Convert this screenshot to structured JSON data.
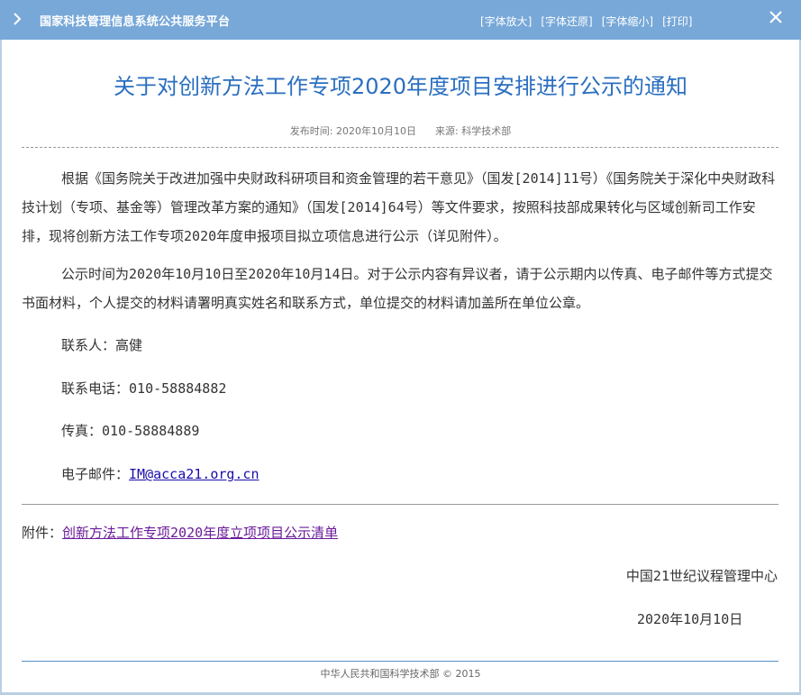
{
  "header": {
    "site_name": "国家科技管理信息系统公共服务平台",
    "tools": [
      "[字体放大]",
      "[字体还原]",
      "[字体缩小]",
      "[打印]"
    ]
  },
  "article": {
    "title": "关于对创新方法工作专项2020年度项目安排进行公示的通知",
    "publish_label": "发布时间:",
    "publish_date": "2020年10月10日",
    "source_label": "来源:",
    "source": "科学技术部",
    "paragraph1": "根据《国务院关于改进加强中央财政科研项目和资金管理的若干意见》（国发[2014]11号）《国务院关于深化中央财政科技计划（专项、基金等）管理改革方案的通知》（国发[2014]64号）等文件要求，按照科技部成果转化与区域创新司工作安排，现将创新方法工作专项2020年度申报项目拟立项信息进行公示（详见附件）。",
    "paragraph2": "公示时间为2020年10月10日至2020年10月14日。对于公示内容有异议者，请于公示期内以传真、电子邮件等方式提交书面材料，个人提交的材料请署明真实姓名和联系方式，单位提交的材料请加盖所在单位公章。",
    "contact_label": "联系人：",
    "contact_name": "高健",
    "phone_label": "联系电话：",
    "phone": "010-58884882",
    "fax_label": "传真：",
    "fax": "010-58884889",
    "email_label": "电子邮件：",
    "email": "IM@acca21.org.cn",
    "attachment_label": "附件：",
    "attachment_link": "创新方法工作专项2020年度立项项目公示清单",
    "organization": "中国21世纪议程管理中心",
    "sign_date": "2020年10月10日"
  },
  "footer": {
    "copyright": "中华人民共和国科学技术部 © 2015"
  }
}
